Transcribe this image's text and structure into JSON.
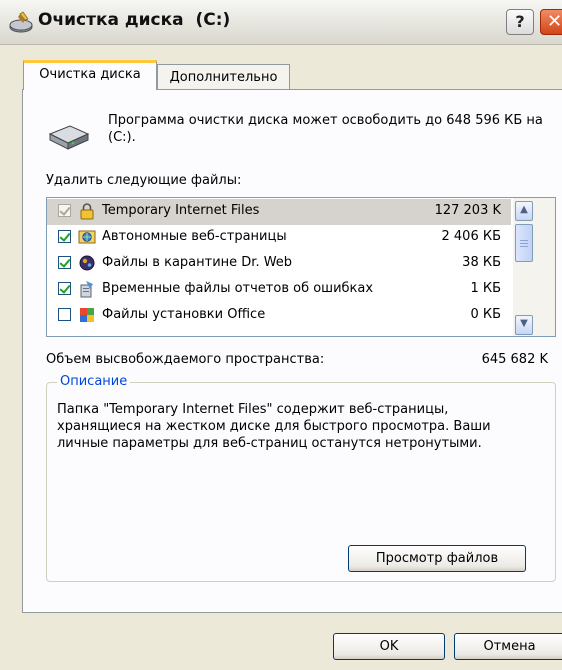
{
  "window": {
    "title": "Очистка диска  (C:)",
    "help_label": "?",
    "close_label": "✕"
  },
  "tabs": [
    {
      "label": "Очистка диска",
      "active": true
    },
    {
      "label": "Дополнительно",
      "active": false
    }
  ],
  "intro": {
    "text": "Программа очистки диска может освободить до 648 596 КБ на  (C:)."
  },
  "files_label": "Удалить следующие файлы:",
  "files": [
    {
      "name": "Temporary Internet Files",
      "size": "127 203 K",
      "checked": true,
      "disabled": true,
      "selected": true,
      "icon": "lock-icon"
    },
    {
      "name": "Автономные веб-страницы",
      "size": "2 406 КБ",
      "checked": true,
      "disabled": false,
      "selected": false,
      "icon": "offline-pages-icon"
    },
    {
      "name": "Файлы в карантине Dr. Web",
      "size": "38 КБ",
      "checked": true,
      "disabled": false,
      "selected": false,
      "icon": "quarantine-icon"
    },
    {
      "name": "Временные файлы отчетов об ошибках",
      "size": "1 КБ",
      "checked": true,
      "disabled": false,
      "selected": false,
      "icon": "error-report-icon"
    },
    {
      "name": "Файлы установки Office",
      "size": "0 КБ",
      "checked": false,
      "disabled": false,
      "selected": false,
      "icon": "office-setup-icon"
    }
  ],
  "free_space": {
    "label": "Объем высвобождаемого пространства:",
    "value": "645 682 K"
  },
  "description": {
    "title": "Описание",
    "text": "Папка \"Temporary Internet Files\" содержит веб-страницы, хранящиеся на жестком диске для быстрого просмотра. Ваши личные параметры для веб-страниц останутся нетронутыми.",
    "view_files_label": "Просмотр файлов"
  },
  "buttons": {
    "ok_label": "OK",
    "cancel_label": "Отмена"
  },
  "colors": {
    "accent_tab": "#ffc83c",
    "group_title": "#0046d5",
    "close_button": "#d44317"
  }
}
